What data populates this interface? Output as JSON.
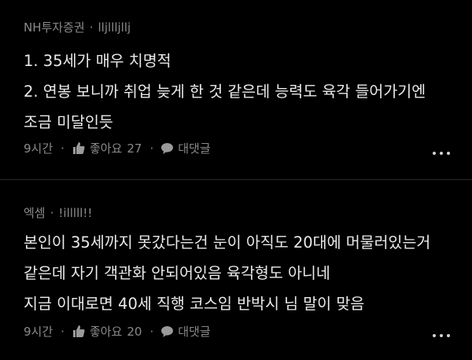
{
  "comments": [
    {
      "author": "NH투자증권",
      "separator": "·",
      "username": "lljllljllj",
      "lines": [
        "1. 35세가 매우 치명적",
        "2. 연봉 보니까 취업 늦게 한 것 같은데 능력도 육각 들어가기엔",
        "조금 미달인듯"
      ],
      "time": "9시간",
      "like_label": "좋아요",
      "like_count": "27",
      "reply_label": "대댓글"
    },
    {
      "author": "엑셈",
      "separator": "·",
      "username": "!illlll!!",
      "lines": [
        "본인이 35세까지 못갔다는건 눈이 아직도 20대에 머물러있는거",
        "같은데 자기 객관화 안되어있음 육각형도 아니네",
        "지금 이대로면 40세 직행 코스임 반박시 님 말이 맞음"
      ],
      "time": "9시간",
      "like_label": "좋아요",
      "like_count": "20",
      "reply_label": "대댓글"
    }
  ],
  "icons": {
    "like": "thumbs-up-icon",
    "reply": "speech-bubble-icon",
    "more": "more-dots-icon"
  }
}
